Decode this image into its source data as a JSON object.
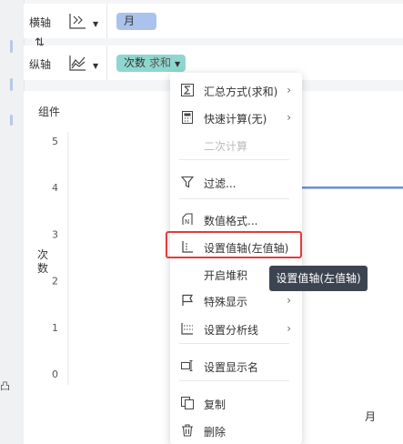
{
  "rows": {
    "horizontal": {
      "label": "横轴",
      "icon": "dimension-axis-icon",
      "pill": "月"
    },
    "vertical": {
      "label": "纵轴",
      "icon": "line-chart-icon",
      "pill_main": "次数",
      "pill_sub": "求和"
    },
    "swap_glyph": "⇅"
  },
  "left_strip": {
    "tag": "凸"
  },
  "chart": {
    "component_label": "组件",
    "ylabel": "次数",
    "xlabel": "月"
  },
  "chart_data": {
    "type": "line",
    "ylabel": "次数",
    "xlabel": "月",
    "ylim": [
      0,
      5
    ],
    "yticks": [
      "5",
      "4",
      "3",
      "2",
      "1",
      "0"
    ],
    "series": [
      {
        "values": [
          4,
          4
        ]
      }
    ],
    "grid": false
  },
  "menu": {
    "items": [
      {
        "id": "summary",
        "label": "汇总方式(求和)",
        "icon": "sigma-icon",
        "submenu": true,
        "disabled": false
      },
      {
        "id": "quick",
        "label": "快速计算(无)",
        "icon": "calculator-icon",
        "submenu": true,
        "disabled": false
      },
      {
        "id": "secondary",
        "label": "二次计算",
        "icon": "",
        "submenu": false,
        "disabled": true
      },
      {
        "id": "filter",
        "label": "过滤...",
        "icon": "filter-icon",
        "submenu": false,
        "disabled": false
      },
      {
        "id": "format",
        "label": "数值格式...",
        "icon": "number-format-icon",
        "submenu": false,
        "disabled": false
      },
      {
        "id": "set-axis",
        "label": "设置值轴(左值轴)",
        "icon": "value-axis-icon",
        "submenu": false,
        "disabled": false
      },
      {
        "id": "stack",
        "label": "开启堆积",
        "icon": "",
        "submenu": false,
        "disabled": false
      },
      {
        "id": "special",
        "label": "特殊显示",
        "icon": "flag-icon",
        "submenu": true,
        "disabled": false
      },
      {
        "id": "analysis",
        "label": "设置分析线",
        "icon": "analysis-line-icon",
        "submenu": true,
        "disabled": false
      },
      {
        "id": "display-name",
        "label": "设置显示名",
        "icon": "rename-icon",
        "submenu": false,
        "disabled": false
      },
      {
        "id": "copy",
        "label": "复制",
        "icon": "copy-icon",
        "submenu": false,
        "disabled": false
      },
      {
        "id": "delete",
        "label": "删除",
        "icon": "trash-icon",
        "submenu": false,
        "disabled": false
      }
    ],
    "submenu_arrow": "›"
  },
  "tooltip": "设置值轴(左值轴)",
  "colors": {
    "accent_line": "#6d8fd6",
    "highlight_border": "#e23b3b",
    "pill_month": "#a9c3ec",
    "pill_count": "#8fd7ce",
    "tooltip_bg": "#3d4451"
  }
}
